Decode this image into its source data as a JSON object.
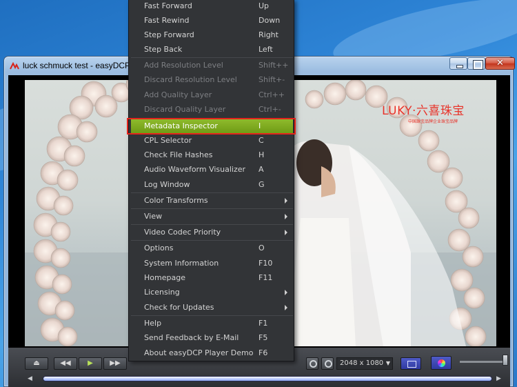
{
  "window": {
    "title": "luck schmuck test - easyDCP P"
  },
  "video": {
    "brand": "LUKY·六喜珠宝",
    "brand_sub": "中国珠宝品牌企业珠宝品牌"
  },
  "controls": {
    "resolution": "2048 x 1080",
    "seek_progress": 1.0
  },
  "menu": {
    "items": [
      {
        "label": "Fast Forward",
        "key": "Up",
        "enabled": true
      },
      {
        "label": "Fast Rewind",
        "key": "Down",
        "enabled": true
      },
      {
        "label": "Step Forward",
        "key": "Right",
        "enabled": true
      },
      {
        "label": "Step Back",
        "key": "Left",
        "enabled": true
      },
      {
        "label": "Add Resolution Level",
        "key": "Shift++",
        "enabled": false
      },
      {
        "label": "Discard Resolution Level",
        "key": "Shift+-",
        "enabled": false
      },
      {
        "label": "Add Quality Layer",
        "key": "Ctrl++",
        "enabled": false
      },
      {
        "label": "Discard Quality Layer",
        "key": "Ctrl+-",
        "enabled": false
      },
      {
        "label": "Metadata Inspector",
        "key": "I",
        "enabled": true,
        "highlighted": true
      },
      {
        "label": "CPL Selector",
        "key": "C",
        "enabled": true
      },
      {
        "label": "Check File Hashes",
        "key": "H",
        "enabled": true
      },
      {
        "label": "Audio Waveform Visualizer",
        "key": "A",
        "enabled": true
      },
      {
        "label": "Log Window",
        "key": "G",
        "enabled": true
      },
      {
        "label": "Color Transforms",
        "key": "",
        "submenu": true
      },
      {
        "label": "View",
        "key": "",
        "submenu": true
      },
      {
        "label": "Video Codec Priority",
        "key": "",
        "submenu": true
      },
      {
        "label": "Options",
        "key": "O",
        "enabled": true
      },
      {
        "label": "System Information",
        "key": "F10",
        "enabled": true
      },
      {
        "label": "Homepage",
        "key": "F11",
        "enabled": true
      },
      {
        "label": "Licensing",
        "key": "",
        "submenu": true
      },
      {
        "label": "Check for Updates",
        "key": "",
        "submenu": true
      },
      {
        "label": "Help",
        "key": "F1",
        "enabled": true
      },
      {
        "label": "Send Feedback by E-Mail",
        "key": "F5",
        "enabled": true
      },
      {
        "label": "About easyDCP Player Demo",
        "key": "F6",
        "enabled": true
      }
    ]
  },
  "colors": {
    "menu_bg": "#323437",
    "highlight": "#7fab1f",
    "focus_outline": "#e5241c"
  }
}
